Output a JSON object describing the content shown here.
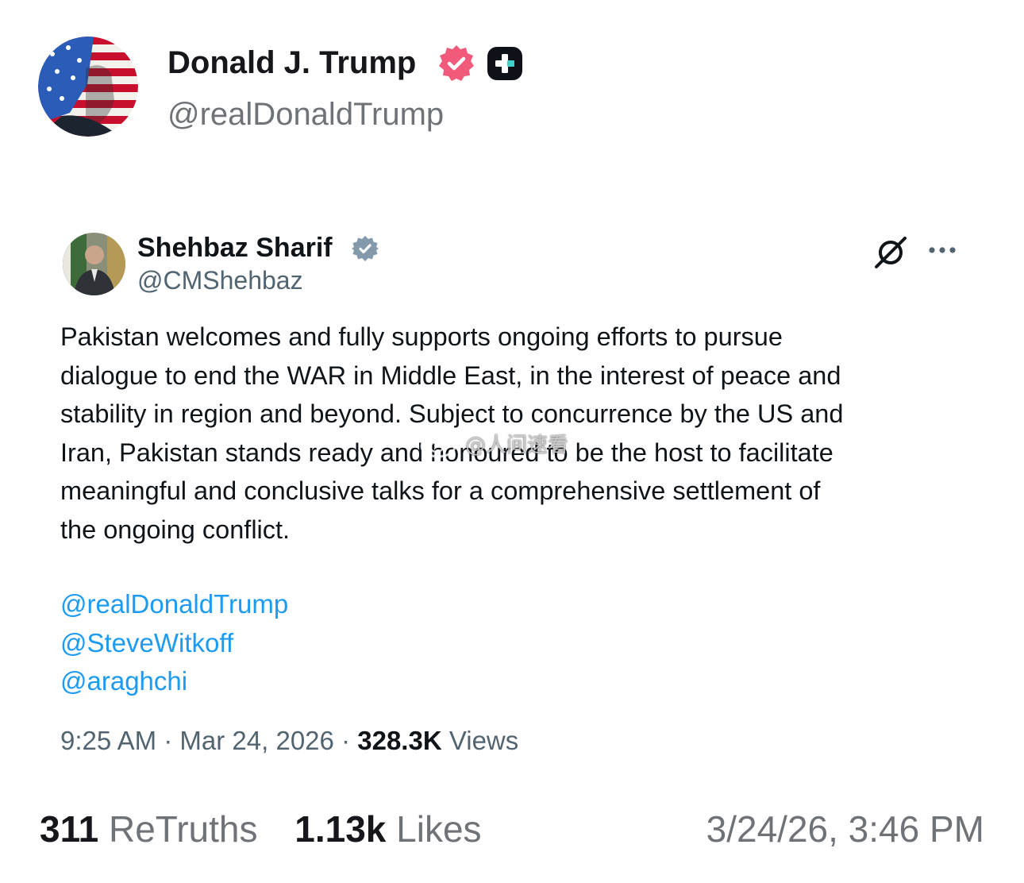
{
  "post": {
    "author_name": "Donald J. Trump",
    "author_handle": "@realDonaldTrump",
    "verified_icon": "verified-badge-icon",
    "plus_icon": "plus-badge-icon",
    "timestamp": "3/24/26, 3:46 PM",
    "stats": {
      "retruths_count": "311",
      "retruths_label": "ReTruths",
      "likes_count": "1.13k",
      "likes_label": "Likes"
    }
  },
  "quoted_tweet": {
    "author_name": "Shehbaz Sharif",
    "author_handle": "@CMShehbaz",
    "body_lines": [
      "Pakistan welcomes and fully supports ongoing efforts to pursue",
      "dialogue to end the WAR in Middle East, in the interest of peace and",
      "stability in region and beyond. Subject to concurrence by the US and",
      "Iran, Pakistan stands ready and honoured to be the host to facilitate",
      "meaningful and conclusive talks for a comprehensive settlement of",
      "the ongoing conflict."
    ],
    "mentions": [
      "@realDonaldTrump",
      "@SteveWitkoff",
      "@araghchi"
    ],
    "time": "9:25 AM",
    "separator": "·",
    "date": "Mar 24, 2026",
    "views_count": "328.3K",
    "views_label": "Views"
  },
  "watermark": {
    "text": "@人间速看"
  },
  "colors": {
    "link": "#1d9bf0",
    "verified_truth": "#f15a7a",
    "verified_x": "#829aab",
    "secondary_text": "#6f7377"
  }
}
